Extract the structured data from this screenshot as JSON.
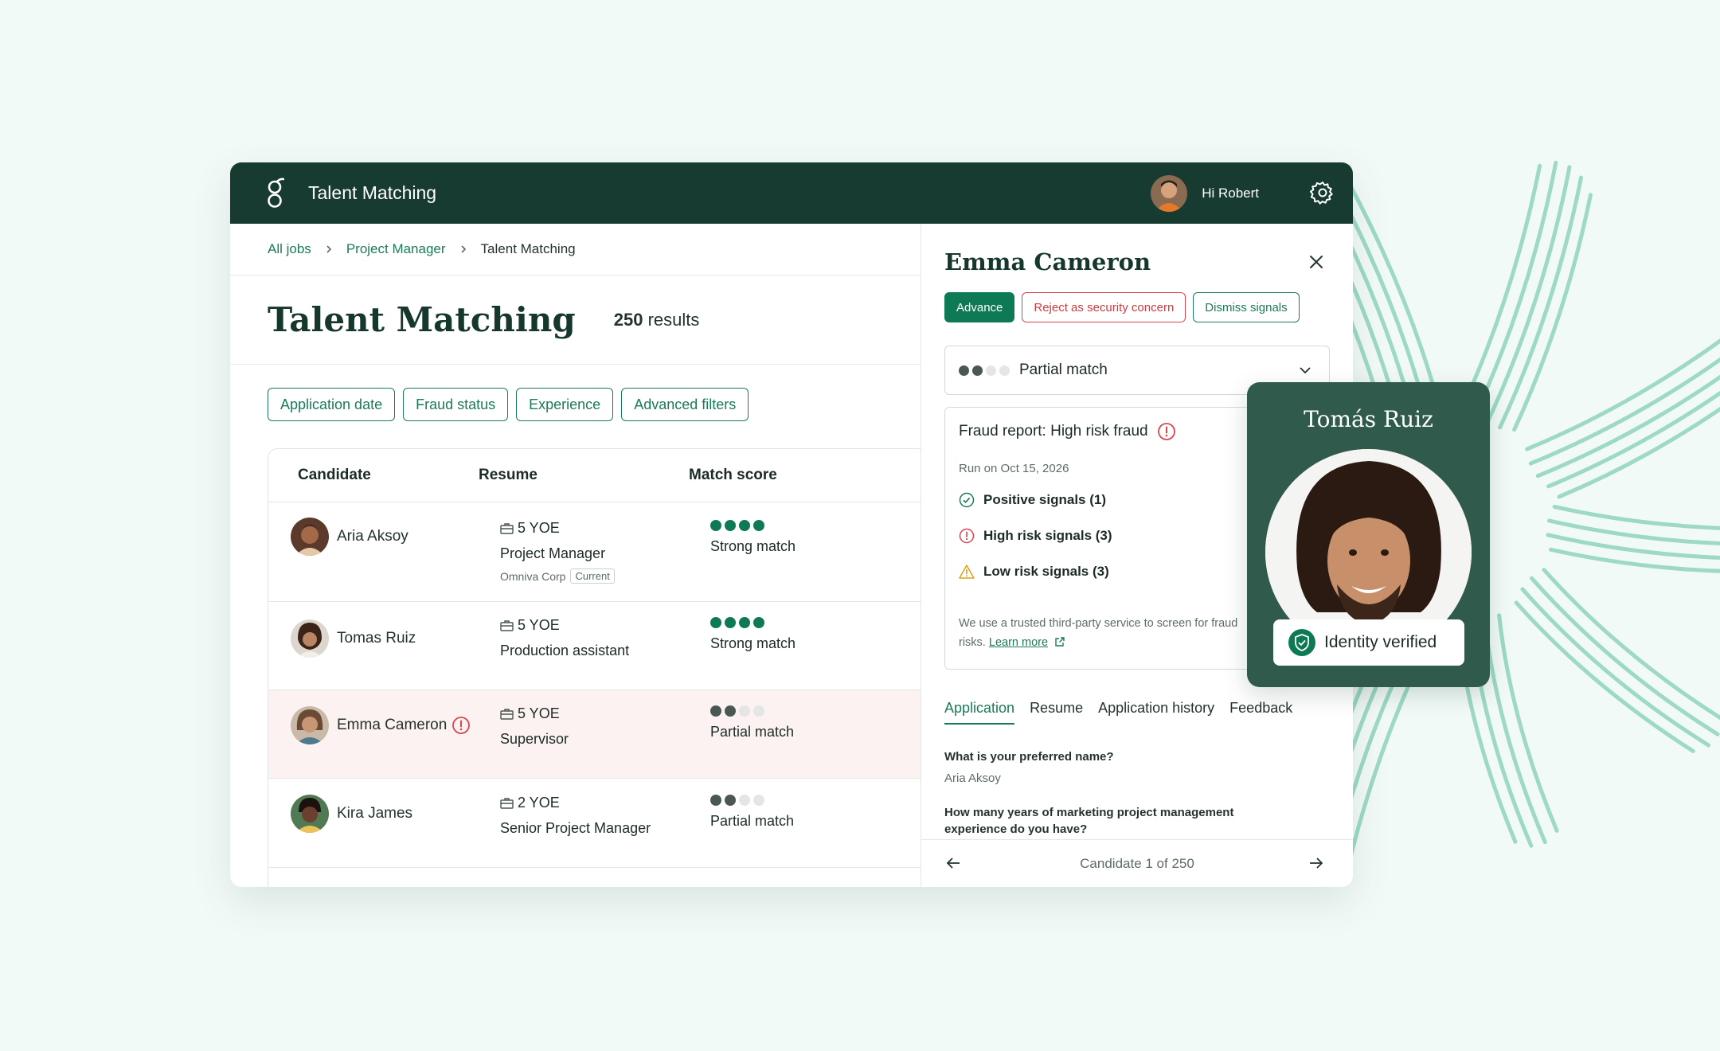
{
  "app": {
    "title": "Talent Matching",
    "greeting": "Hi Robert"
  },
  "breadcrumb": {
    "items": [
      "All jobs",
      "Project Manager",
      "Talent Matching"
    ]
  },
  "page": {
    "title": "Talent Matching",
    "result_count": "250",
    "result_suffix": "results"
  },
  "filters": [
    "Application date",
    "Fraud status",
    "Experience",
    "Advanced filters"
  ],
  "table": {
    "columns": [
      "Candidate",
      "Resume",
      "Match score"
    ],
    "rows": [
      {
        "name": "Aria Aksoy",
        "yoe": "5 YOE",
        "role": "Project Manager",
        "company": "Omniva Corp",
        "tag": "Current",
        "match_label": "Strong match",
        "match_level": 4,
        "flagged": false
      },
      {
        "name": "Tomas Ruiz",
        "yoe": "5 YOE",
        "role": "Production assistant",
        "match_label": "Strong match",
        "match_level": 4,
        "flagged": false
      },
      {
        "name": "Emma Cameron",
        "yoe": "5 YOE",
        "role": "Supervisor",
        "match_label": "Partial match",
        "match_level": 2,
        "flagged": true
      },
      {
        "name": "Kira James",
        "yoe": "2 YOE",
        "role": "Senior Project Manager",
        "match_label": "Partial match",
        "match_level": 2,
        "flagged": false
      }
    ]
  },
  "panel": {
    "candidate_name": "Emma Cameron",
    "actions": {
      "advance": "Advance",
      "reject": "Reject as security concern",
      "dismiss": "Dismiss signals"
    },
    "match_select": {
      "label": "Partial match",
      "level": 2
    },
    "fraud": {
      "title": "Fraud report: High risk fraud",
      "date": "Run on Oct 15, 2026",
      "positive": "Positive signals (1)",
      "high": "High risk signals (3)",
      "low": "Low risk signals (3)",
      "note": "We use a trusted third-party service to screen for fraud risks.",
      "learn_more": "Learn more"
    },
    "tabs": [
      "Application",
      "Resume",
      "Application history",
      "Feedback"
    ],
    "questions": [
      {
        "q": "What is your preferred name?",
        "a": "Aria Aksoy"
      },
      {
        "q": "How many years of marketing project management experience do you have?"
      }
    ],
    "pager": "Candidate 1 of 250"
  },
  "id_card": {
    "name": "Tomás Ruiz",
    "status": "Identity verified"
  },
  "colors": {
    "brand_dark": "#173b31",
    "accent": "#1b7a5a",
    "danger": "#d8454c",
    "warning": "#d9a21b",
    "dot_filled": "#0e7a55",
    "dot_partial": "#4a5752",
    "dot_empty": "#e3e6e5"
  },
  "icons": [
    "logo-icon",
    "gear-icon",
    "chevron-right-icon",
    "briefcase-icon",
    "alert-circle-icon",
    "close-icon",
    "chevron-down-icon",
    "check-circle-icon",
    "warning-triangle-icon",
    "external-link-icon",
    "arrow-left-icon",
    "arrow-right-icon",
    "shield-check-icon"
  ]
}
